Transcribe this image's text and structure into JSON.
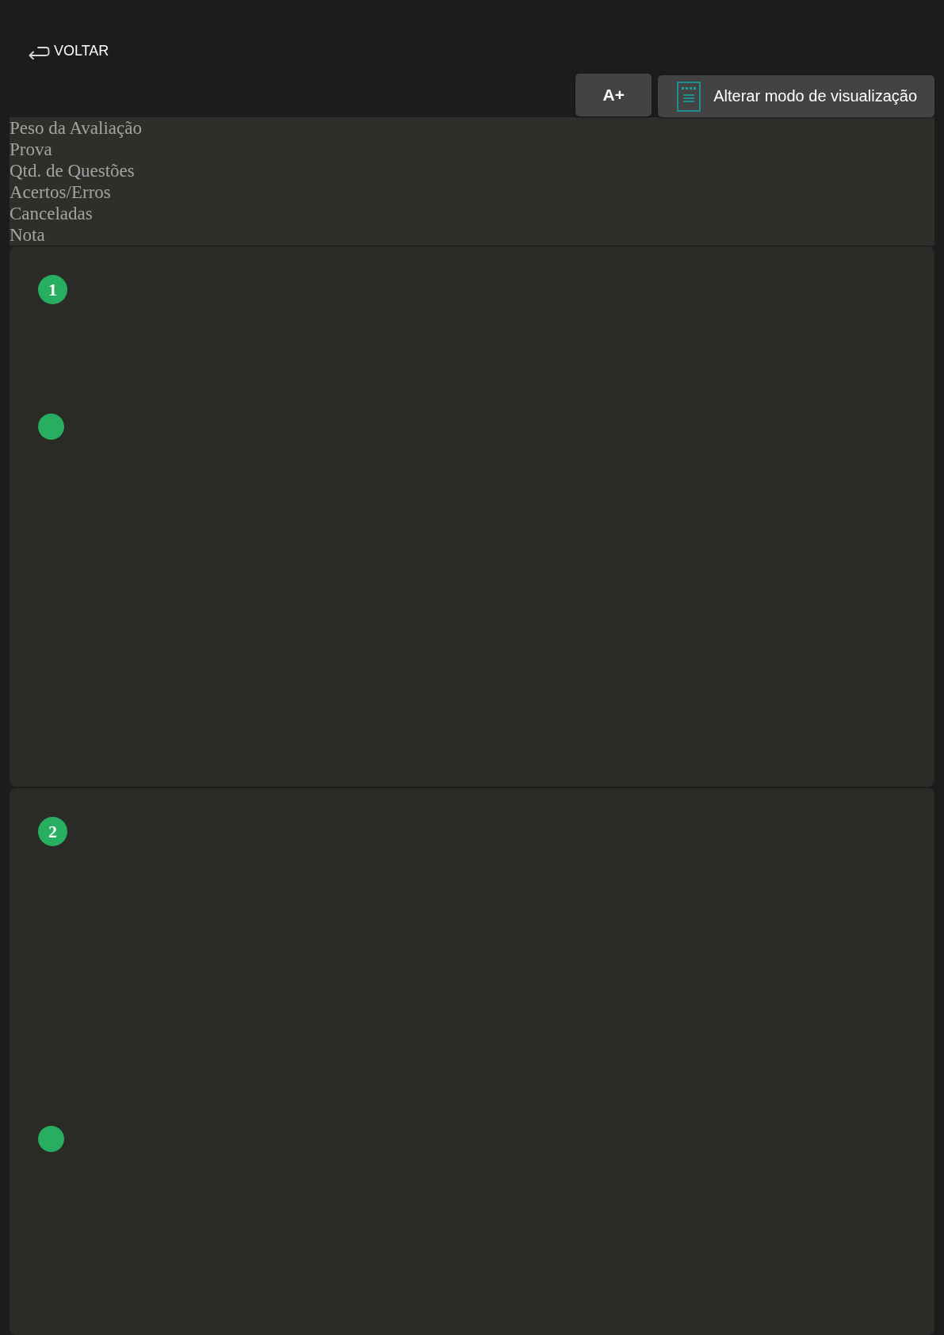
{
  "back_link": {
    "label": "VOLTAR"
  },
  "toolbar": {
    "buttons": [
      {
        "kind": "text",
        "label": "A+"
      },
      {
        "kind": "icon_text",
        "label": "Alterar modo de visualização"
      }
    ]
  },
  "summary": {
    "rows": [
      "Peso da Avaliação",
      "Prova",
      "Qtd. de Questões",
      "Acertos/Erros",
      "Canceladas",
      "Nota"
    ]
  },
  "questions": [
    {
      "number": "1"
    },
    {
      "number": "2"
    }
  ]
}
